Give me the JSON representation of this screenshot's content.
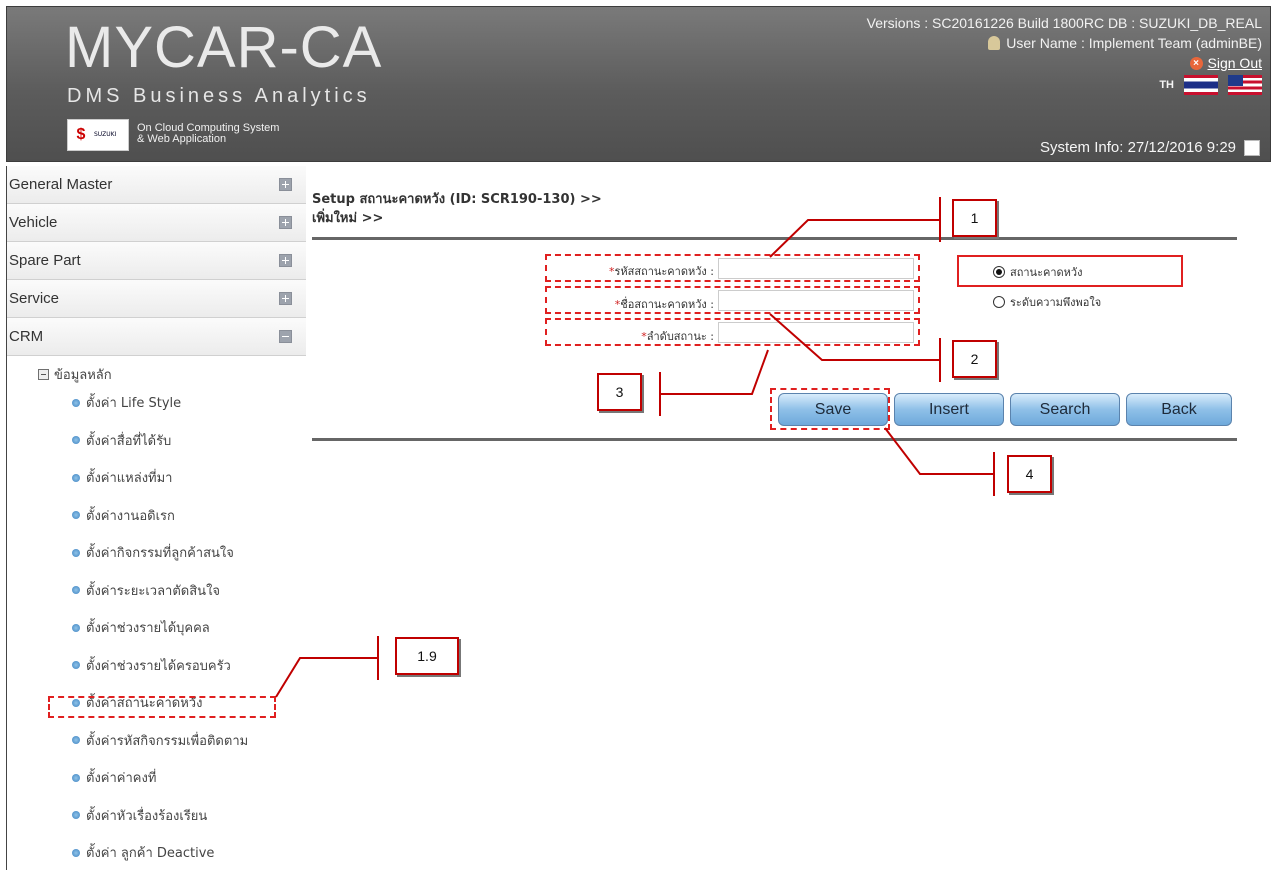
{
  "header": {
    "logo_title": "MYCAR-CA",
    "logo_subtitle": "DMS Business Analytics",
    "brand_small": "SUZUKI",
    "cloud_line1": "On Cloud Computing System",
    "cloud_line2": "& Web Application",
    "version_text": "Versions : SC20161226 Build 1800RC DB : SUZUKI_DB_REAL",
    "user_text": "User Name : Implement Team (adminBE)",
    "signout_label": "Sign Out",
    "lang_label": "TH",
    "system_info": "System Info: 27/12/2016 9:29"
  },
  "sidebar": {
    "menus": [
      {
        "label": "General Master",
        "state": "plus"
      },
      {
        "label": "Vehicle",
        "state": "plus"
      },
      {
        "label": "Spare Part",
        "state": "plus"
      },
      {
        "label": "Service",
        "state": "plus"
      },
      {
        "label": "CRM",
        "state": "minus"
      }
    ],
    "tree_root": "ข้อมูลหลัก",
    "tree_items": [
      "ตั้งค่า Life Style",
      "ตั้งค่าสื่อที่ได้รับ",
      "ตั้งค่าแหล่งที่มา",
      "ตั้งค่างานอดิเรก",
      "ตั้งค่ากิจกรรมที่ลูกค้าสนใจ",
      "ตั้งค่าระยะเวลาตัดสินใจ",
      "ตั้งค่าช่วงรายได้บุคคล",
      "ตั้งค่าช่วงรายได้ครอบครัว",
      "ตั้งค่าสถานะคาดหวัง",
      "ตั้งค่ารหัสกิจกรรมเพื่อติดตาม",
      "ตั้งค่าค่าคงที่",
      "ตั้งค่าหัวเรื่องร้องเรียน",
      "ตั้งค่า ลูกค้า Deactive"
    ]
  },
  "main": {
    "breadcrumb_line1": "Setup สถานะคาดหวัง (ID: SCR190-130) >>",
    "breadcrumb_line2": "เพิ่มใหม่ >>",
    "fields": [
      {
        "label": "รหัสสถานะคาดหวัง :",
        "value": ""
      },
      {
        "label": "ชื่อสถานะคาดหวัง :",
        "value": ""
      },
      {
        "label": "ลำดับสถานะ :",
        "value": ""
      }
    ],
    "required_mark": "*",
    "radios": [
      {
        "label": "สถานะคาดหวัง",
        "checked": true
      },
      {
        "label": "ระดับความพึงพอใจ",
        "checked": false
      }
    ],
    "buttons": {
      "save": "Save",
      "insert": "Insert",
      "search": "Search",
      "back": "Back"
    }
  },
  "annotations": {
    "c1": "1",
    "c2": "2",
    "c3": "3",
    "c4": "4",
    "c19": "1.9",
    "color": "#e02020"
  }
}
